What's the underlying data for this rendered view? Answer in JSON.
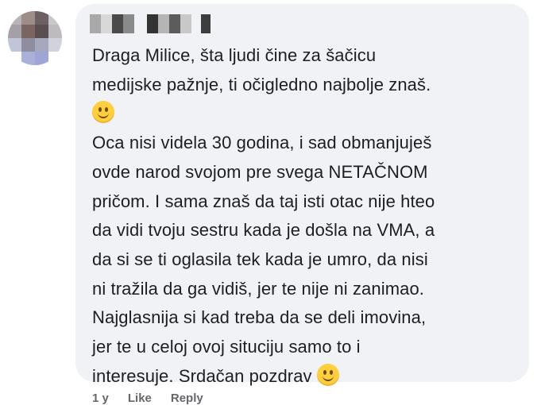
{
  "comment": {
    "lines": [
      "Draga Milice, šta ljudi čine za šačicu",
      "medijske pažnje, ti očigledno najbolje znaš.",
      "",
      "Oca nisi videla 30 godina, i sad obmanjuješ",
      "ovde narod svojom pre svega NETAČNOM",
      "pričom. I sama znaš da taj isti otac nije hteo",
      "da vidi tvoju sestru kada je došla na VMA, a",
      "da si se ti oglasila tek kada je umro, da nisi",
      "ni tražila da ga vidiš, jer te nije ni zanimao.",
      "Najglasnija si kad treba da se deli imovina,",
      "jer te u celoj ovoj situciju samo to i",
      "interesuje. Srdačan pozdrav"
    ],
    "emoji": "smiling-face-emoji"
  },
  "actions": {
    "time": "1 y",
    "like": "Like",
    "reply": "Reply"
  },
  "colors": {
    "bubble": "#f0f2f5",
    "text": "#1c1e21",
    "meta": "#65676b"
  }
}
